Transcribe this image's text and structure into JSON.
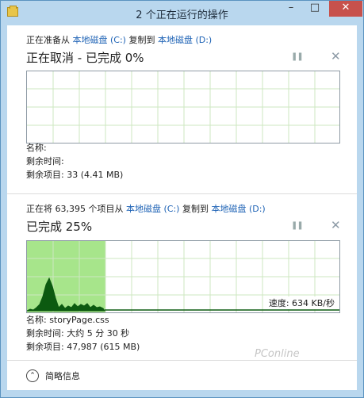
{
  "window": {
    "title": "2 个正在运行的操作"
  },
  "op1": {
    "from_prefix": "正在准备从",
    "src": "本地磁盘 (C:)",
    "mid": "复制到",
    "dst": "本地磁盘 (D:)",
    "status": "正在取消 - 已完成 0%",
    "name_label": "名称:",
    "time_label": "剩余时间:",
    "items_label": "剩余项目: 33 (4.41 MB)"
  },
  "op2": {
    "from_prefix": "正在将 63,395 个项目从",
    "src": "本地磁盘 (C:)",
    "mid": "复制到",
    "dst": "本地磁盘 (D:)",
    "status": "已完成 25%",
    "progress": 0.25,
    "speed": "速度: 634 KB/秒",
    "name_label": "名称: storyPage.css",
    "time_label": "剩余时间: 大约 5 分 30 秒",
    "items_label": "剩余项目: 47,987 (615 MB)"
  },
  "footer": {
    "toggle_label": "简略信息"
  },
  "watermark": "PConline",
  "colors": {
    "accent": "#1d62b5",
    "progress_fill": "#a7e58b",
    "graph_line": "#0c5a10"
  }
}
